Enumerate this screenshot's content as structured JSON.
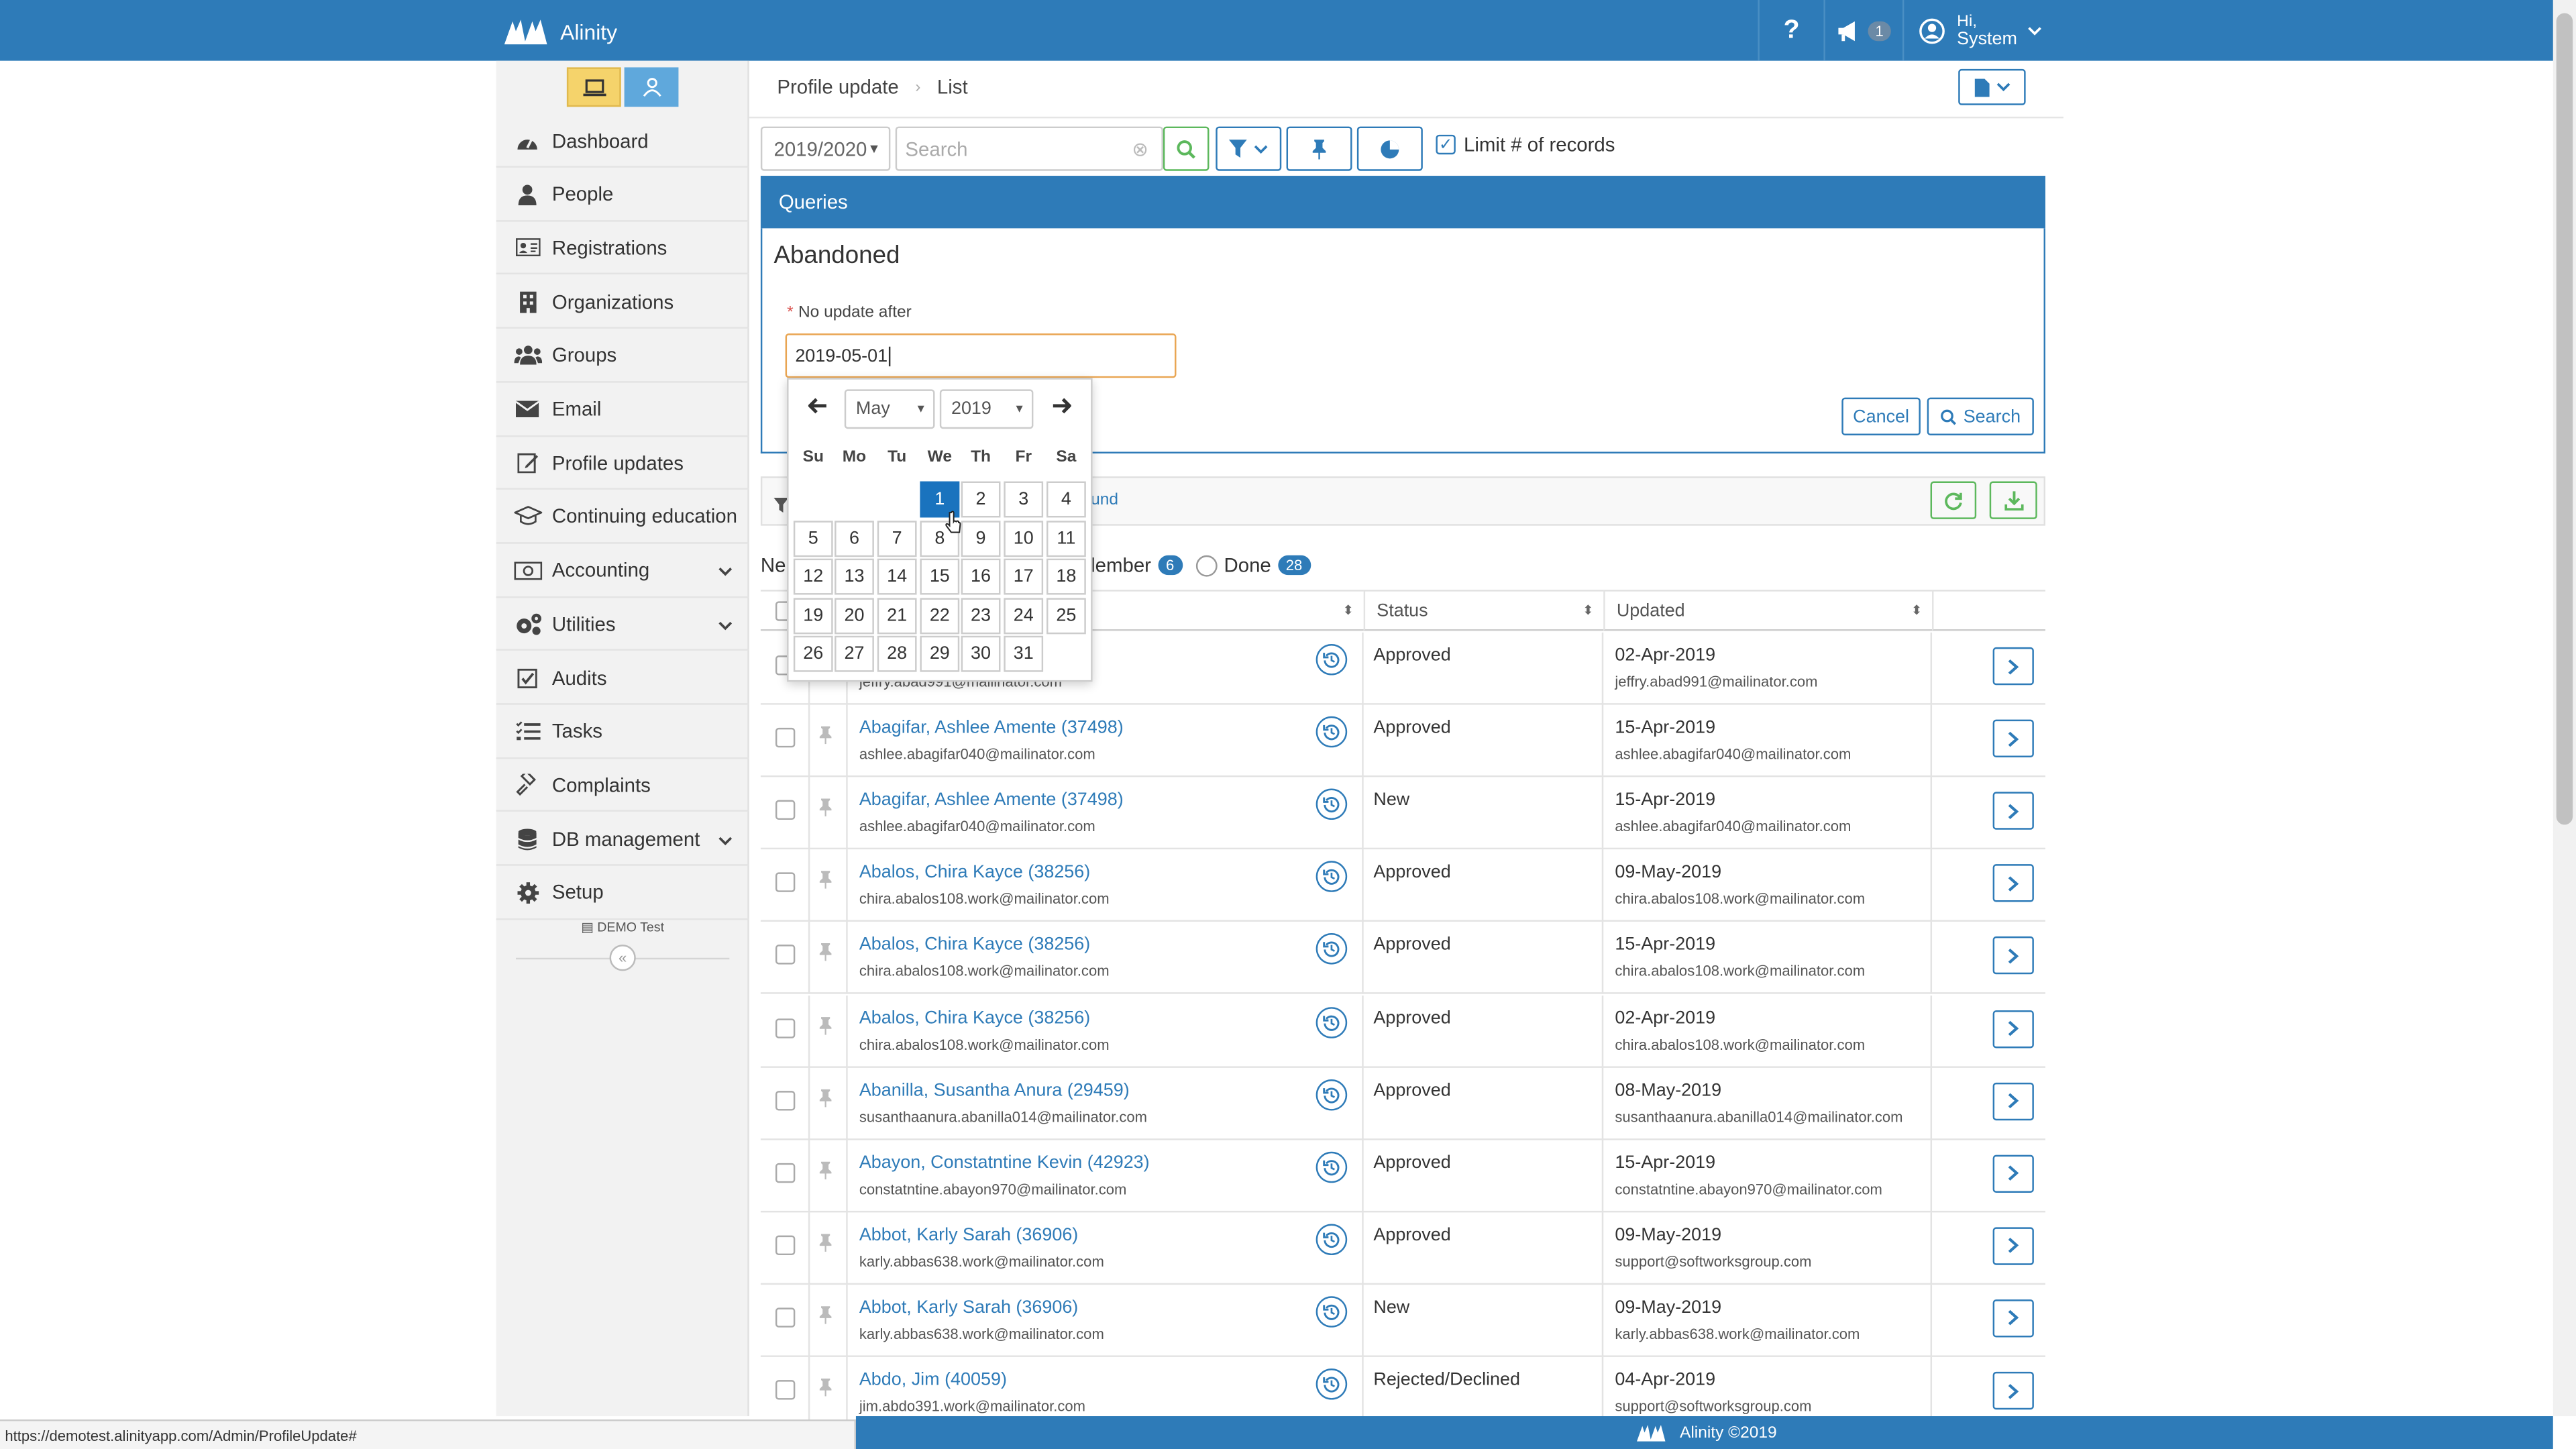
{
  "app": {
    "brand": "Alinity",
    "help_label": "?",
    "notification_count": "1",
    "user_greeting": "Hi,",
    "user_name": "System",
    "footer": "Alinity ©2019",
    "status_url": "https://demotest.alinityapp.com/Admin/ProfileUpdate#"
  },
  "sidebar": {
    "items": [
      {
        "label": "Dashboard",
        "icon": "dashboard-icon"
      },
      {
        "label": "People",
        "icon": "person-icon"
      },
      {
        "label": "Registrations",
        "icon": "id-card-icon"
      },
      {
        "label": "Organizations",
        "icon": "building-icon"
      },
      {
        "label": "Groups",
        "icon": "users-icon"
      },
      {
        "label": "Email",
        "icon": "envelope-icon"
      },
      {
        "label": "Profile updates",
        "icon": "edit-icon"
      },
      {
        "label": "Continuing education",
        "icon": "graduation-cap-icon"
      },
      {
        "label": "Accounting",
        "icon": "money-icon"
      },
      {
        "label": "Utilities",
        "icon": "cogs-icon"
      },
      {
        "label": "Audits",
        "icon": "check-square-icon"
      },
      {
        "label": "Tasks",
        "icon": "tasks-icon"
      },
      {
        "label": "Complaints",
        "icon": "gavel-icon"
      },
      {
        "label": "DB management",
        "icon": "database-icon"
      },
      {
        "label": "Setup",
        "icon": "gear-icon"
      }
    ],
    "demo_label": "DEMO Test",
    "collapse_label": "«"
  },
  "header": {
    "breadcrumb": [
      "Profile update",
      "List"
    ]
  },
  "toolbar": {
    "year_value": "2019/2020",
    "search_placeholder": "Search",
    "limit_label": "Limit # of records",
    "limit_checked": true
  },
  "queries": {
    "panel_title": "Queries",
    "query_name": "Abandoned",
    "field_label": "No update after",
    "field_value": "2019-05-01",
    "cancel_label": "Cancel",
    "search_label": "Search"
  },
  "datepicker": {
    "month": "May",
    "year": "2019",
    "weekdays": [
      "Su",
      "Mo",
      "Tu",
      "We",
      "Th",
      "Fr",
      "Sa"
    ],
    "first_weekday_index": 3,
    "days_in_month": 31,
    "selected_day": 1
  },
  "list": {
    "found_fragment": "und",
    "next_fragment": "Ne",
    "member_label": "lember",
    "member_count": "6",
    "done_label": "Done",
    "done_count": "28",
    "columns": {
      "status": "Status",
      "updated": "Updated"
    },
    "rows": [
      {
        "name": "",
        "email": "jeffry.abad991@mailinator.com",
        "status": "Approved",
        "updated": "02-Apr-2019",
        "updated_email": "jeffry.abad991@mailinator.com"
      },
      {
        "name": "Abagifar, Ashlee Amente (37498)",
        "email": "ashlee.abagifar040@mailinator.com",
        "status": "Approved",
        "updated": "15-Apr-2019",
        "updated_email": "ashlee.abagifar040@mailinator.com"
      },
      {
        "name": "Abagifar, Ashlee Amente (37498)",
        "email": "ashlee.abagifar040@mailinator.com",
        "status": "New",
        "updated": "15-Apr-2019",
        "updated_email": "ashlee.abagifar040@mailinator.com"
      },
      {
        "name": "Abalos, Chira Kayce (38256)",
        "email": "chira.abalos108.work@mailinator.com",
        "status": "Approved",
        "updated": "09-May-2019",
        "updated_email": "chira.abalos108.work@mailinator.com"
      },
      {
        "name": "Abalos, Chira Kayce (38256)",
        "email": "chira.abalos108.work@mailinator.com",
        "status": "Approved",
        "updated": "15-Apr-2019",
        "updated_email": "chira.abalos108.work@mailinator.com"
      },
      {
        "name": "Abalos, Chira Kayce (38256)",
        "email": "chira.abalos108.work@mailinator.com",
        "status": "Approved",
        "updated": "02-Apr-2019",
        "updated_email": "chira.abalos108.work@mailinator.com"
      },
      {
        "name": "Abanilla, Susantha Anura (29459)",
        "email": "susanthaanura.abanilla014@mailinator.com",
        "status": "Approved",
        "updated": "08-May-2019",
        "updated_email": "susanthaanura.abanilla014@mailinator.com"
      },
      {
        "name": "Abayon, Constatntine Kevin (42923)",
        "email": "constatntine.abayon970@mailinator.com",
        "status": "Approved",
        "updated": "15-Apr-2019",
        "updated_email": "constatntine.abayon970@mailinator.com"
      },
      {
        "name": "Abbot, Karly Sarah (36906)",
        "email": "karly.abbas638.work@mailinator.com",
        "status": "Approved",
        "updated": "09-May-2019",
        "updated_email": "support@softworksgroup.com"
      },
      {
        "name": "Abbot, Karly Sarah (36906)",
        "email": "karly.abbas638.work@mailinator.com",
        "status": "New",
        "updated": "09-May-2019",
        "updated_email": "karly.abbas638.work@mailinator.com"
      },
      {
        "name": "Abdo, Jim (40059)",
        "email": "jim.abdo391.work@mailinator.com",
        "status": "Rejected/Declined",
        "updated": "04-Apr-2019",
        "updated_email": "support@softworksgroup.com"
      }
    ]
  },
  "colors": {
    "primary": "#2e7bb8",
    "accent_yellow": "#f5d36b",
    "success": "#5cb85c",
    "focus_border": "#e9a552"
  }
}
